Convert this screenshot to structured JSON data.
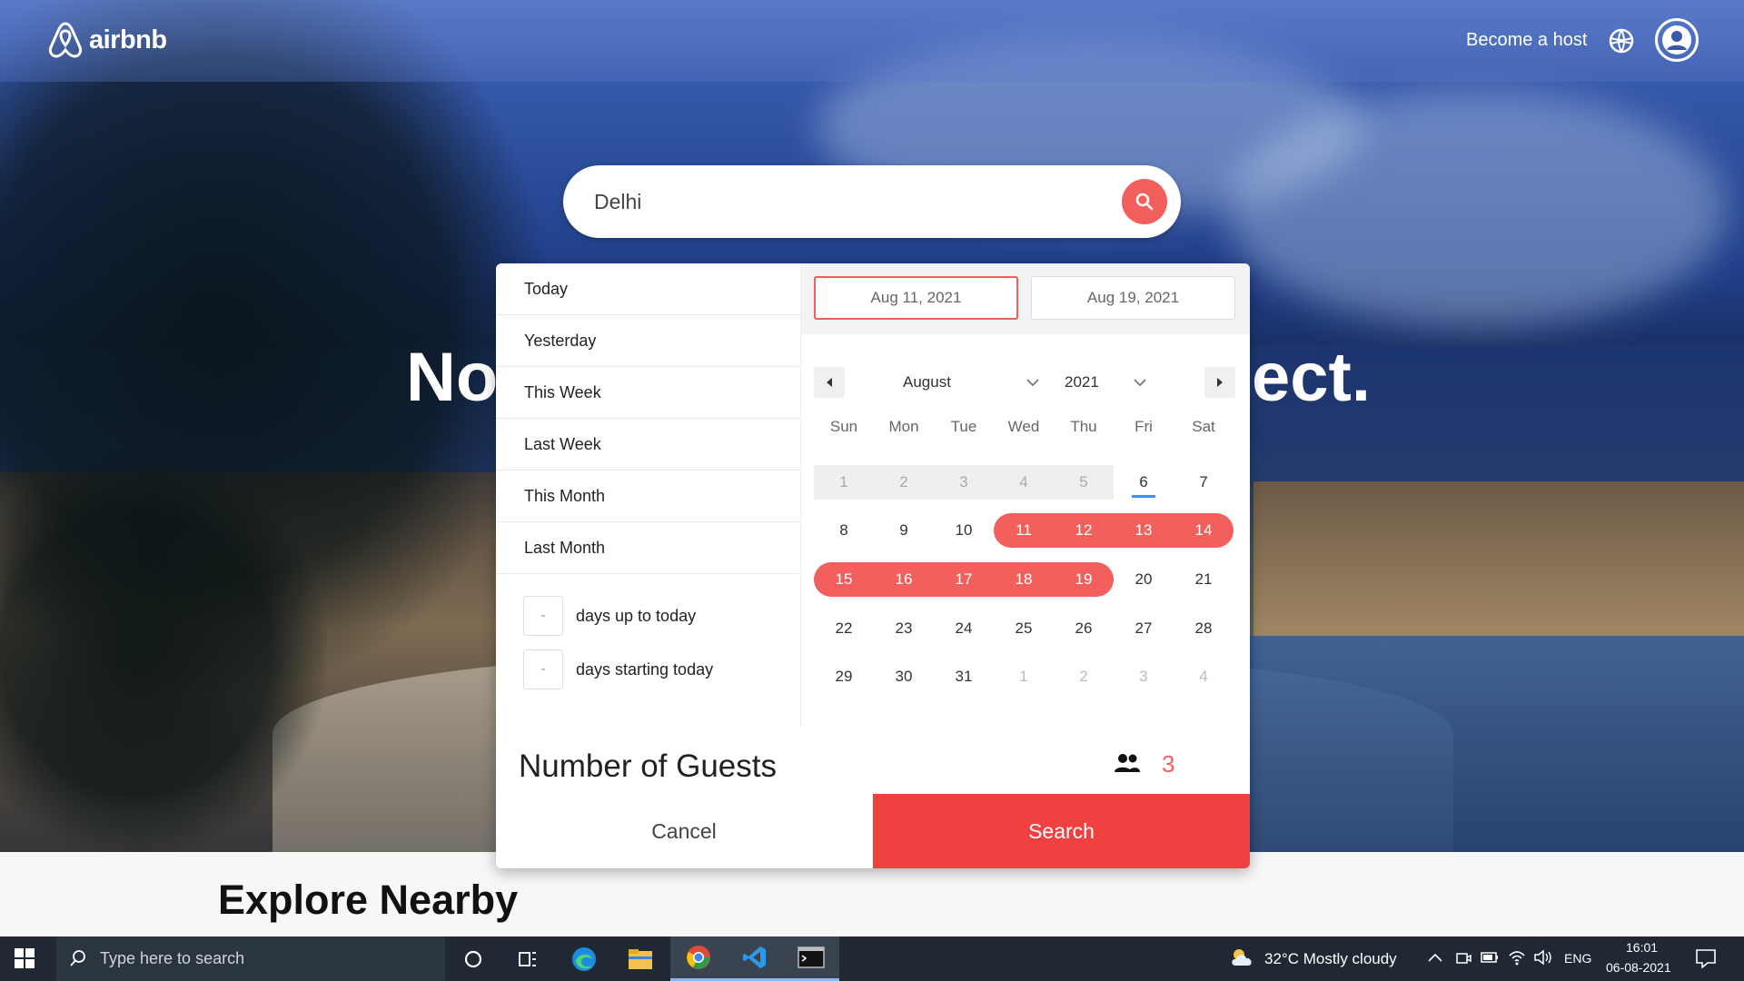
{
  "header": {
    "brand": "airbnb",
    "host_link": "Become a host"
  },
  "search": {
    "value": "Delhi",
    "placeholder": ""
  },
  "hero": {
    "headline_left": "No",
    "headline_right": "ect."
  },
  "picker": {
    "ranges": [
      "Today",
      "Yesterday",
      "This Week",
      "Last Week",
      "This Month",
      "Last Month"
    ],
    "days_up_value": "-",
    "days_up_label": "days up to today",
    "days_start_value": "-",
    "days_start_label": "days starting today",
    "start_date": "Aug 11, 2021",
    "end_date": "Aug 19, 2021",
    "month": "August",
    "year": "2021",
    "weekdays": [
      "Sun",
      "Mon",
      "Tue",
      "Wed",
      "Thu",
      "Fri",
      "Sat"
    ],
    "weeks": [
      [
        "1",
        "2",
        "3",
        "4",
        "5",
        "6",
        "7"
      ],
      [
        "8",
        "9",
        "10",
        "11",
        "12",
        "13",
        "14"
      ],
      [
        "15",
        "16",
        "17",
        "18",
        "19",
        "20",
        "21"
      ],
      [
        "22",
        "23",
        "24",
        "25",
        "26",
        "27",
        "28"
      ],
      [
        "29",
        "30",
        "31",
        "1",
        "2",
        "3",
        "4"
      ]
    ]
  },
  "guests": {
    "label": "Number of Guests",
    "count": "3"
  },
  "actions": {
    "cancel": "Cancel",
    "search": "Search"
  },
  "section": {
    "explore": "Explore Nearby"
  },
  "taskbar": {
    "search_text": "Type here to search",
    "weather": "32°C  Mostly cloudy",
    "lang": "ENG",
    "time": "16:01",
    "date": "06-08-2021"
  },
  "colors": {
    "accent": "#f25f5c",
    "search_button": "#f0403f",
    "today_underline": "#3d91ff"
  }
}
